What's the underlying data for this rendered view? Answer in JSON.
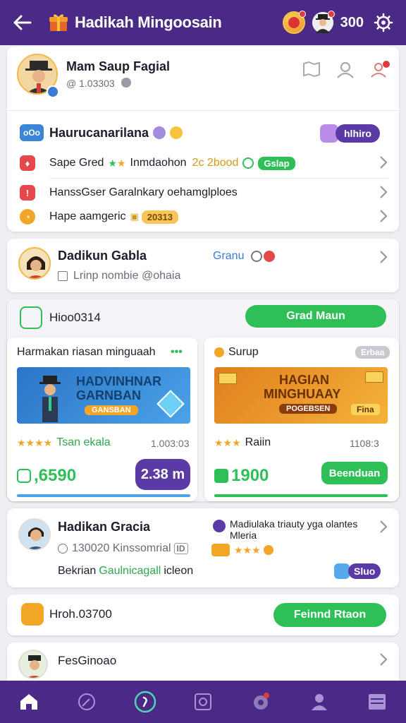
{
  "header": {
    "title": "Hadikah Mingoosain",
    "points": "300"
  },
  "profile": {
    "name": "Mam Saup Fagial",
    "handle": "@ 1.03303"
  },
  "rewards": {
    "title": "Haurucanarilana",
    "badge": "hlhiro",
    "items": [
      {
        "label": "Sape Gred",
        "detail": "Inmdaohon",
        "value": "2c 2bood",
        "tag": "Gslap"
      },
      {
        "label": "HanssGser Garalnkary oehamglploes"
      },
      {
        "label": "Hape aamgeric",
        "tag": "20313"
      }
    ]
  },
  "friend_card": {
    "name": "Dadikun Gabla",
    "status": "Granu",
    "subtitle": "Lrinp nombie @ohaia"
  },
  "promo": {
    "code": "Hioo0314",
    "button": "Grad Maun",
    "left": {
      "title": "Harmakan riasan minguaah",
      "banner_line1": "HADVINHNAR",
      "banner_line2": "GARNBAN",
      "banner_small": "GANSBAN",
      "rating_label": "Tsan ekala",
      "rating_value": "1.003:03",
      "price": ",6590",
      "price_pill": "2.38 m"
    },
    "right": {
      "title": "Surup",
      "tag": "Erbaa",
      "banner_line1": "HAGIAN",
      "banner_line2": "MINGHUAAY",
      "banner_small": "POGEBSEN",
      "banner_btn": "Fina",
      "rating_label": "Raiin",
      "rating_value": "1108:3",
      "price": "1900",
      "button": "Beenduan"
    }
  },
  "second_friend": {
    "name": "Hadikan Gracia",
    "meta": "130020 Kinssomrial",
    "meta_pill": "ID",
    "desc_a": "Bekrian",
    "desc_b": "Gaulnicagall",
    "desc_c": "icleon",
    "side_text": "Madiulaka triauty yga olantes Mleria",
    "pill": "Sluo"
  },
  "reward_bar": {
    "code": "Hroh.03700",
    "button": "Feinnd Rtaon"
  },
  "last_item": {
    "name": "FesGinoao"
  },
  "colors": {
    "brand": "#4a2a86",
    "green": "#2fbf57",
    "purple": "#5a3ba5",
    "orange": "#f2a627"
  }
}
